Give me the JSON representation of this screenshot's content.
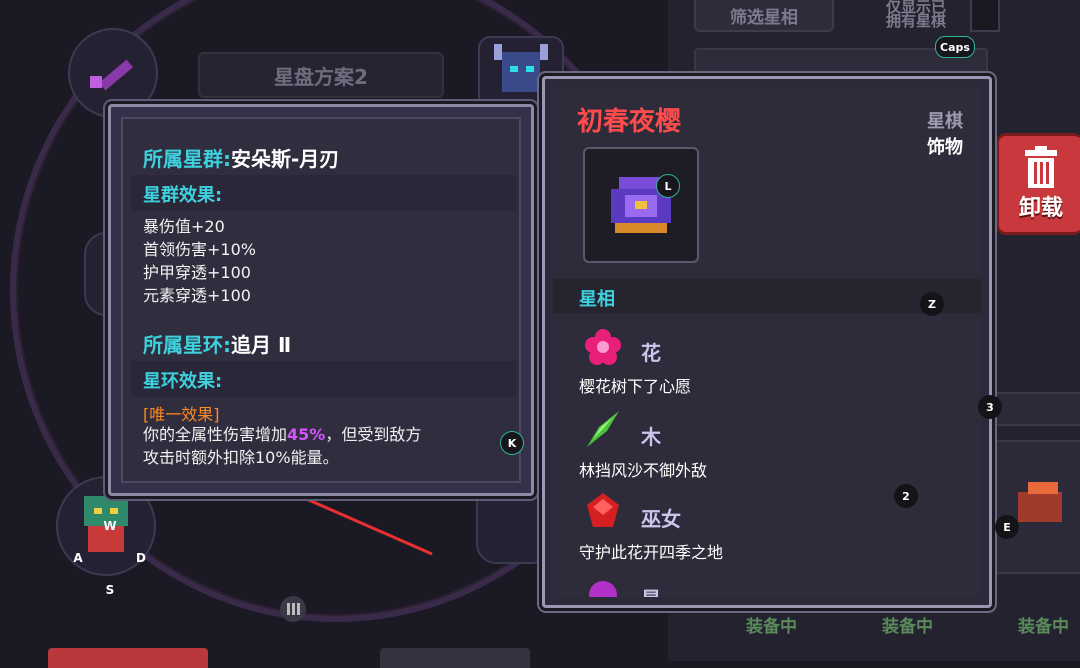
{
  "background": {
    "plan_title": "星盘方案2",
    "filter_button": "筛选星相",
    "own_label": "仅显示已拥有星棋",
    "unload_button": "卸载",
    "equipped_labels": [
      "装备中",
      "装备中",
      "装备中"
    ]
  },
  "constellation_panel": {
    "group_label": "所属星群:",
    "group_value": "安朵斯-月刃",
    "group_effect_title": "星群效果:",
    "group_effects": [
      "暴伤值+20",
      "首领伤害+10%",
      "护甲穿透+100",
      "元素穿透+100"
    ],
    "ring_label": "所属星环:",
    "ring_value": "追月 Ⅱ",
    "ring_effect_title": "星环效果:",
    "unique_tag": "[唯一效果]",
    "unique_line1_a": "你的全属性伤害增加",
    "unique_line1_hl": "45%",
    "unique_line1_b": "，但受到敌方",
    "unique_line2": "攻击时额外扣除10%能量。"
  },
  "item_card": {
    "name": "初春夜樱",
    "category": "星棋",
    "subcategory": "饰物",
    "aspects_header": "星相",
    "aspects": [
      {
        "name": "花",
        "desc": "樱花树下了心愿",
        "icon": "pink-flower-gem-icon",
        "color": "#e8207a"
      },
      {
        "name": "木",
        "desc": "林挡风沙不御外敌",
        "icon": "green-leaf-gem-icon",
        "color": "#4cc23a"
      },
      {
        "name": "巫女",
        "desc": "守护此花开四季之地",
        "icon": "red-gem-icon",
        "color": "#d42020"
      },
      {
        "name": "星",
        "desc": "",
        "icon": "purple-gem-icon",
        "color": "#b030c8"
      }
    ]
  },
  "key_hints": {
    "caps": "Caps",
    "l": "L",
    "k": "K",
    "z": "Z",
    "three": "3",
    "two": "2",
    "e": "E",
    "w": "W",
    "a": "A",
    "s": "S",
    "d": "D"
  }
}
